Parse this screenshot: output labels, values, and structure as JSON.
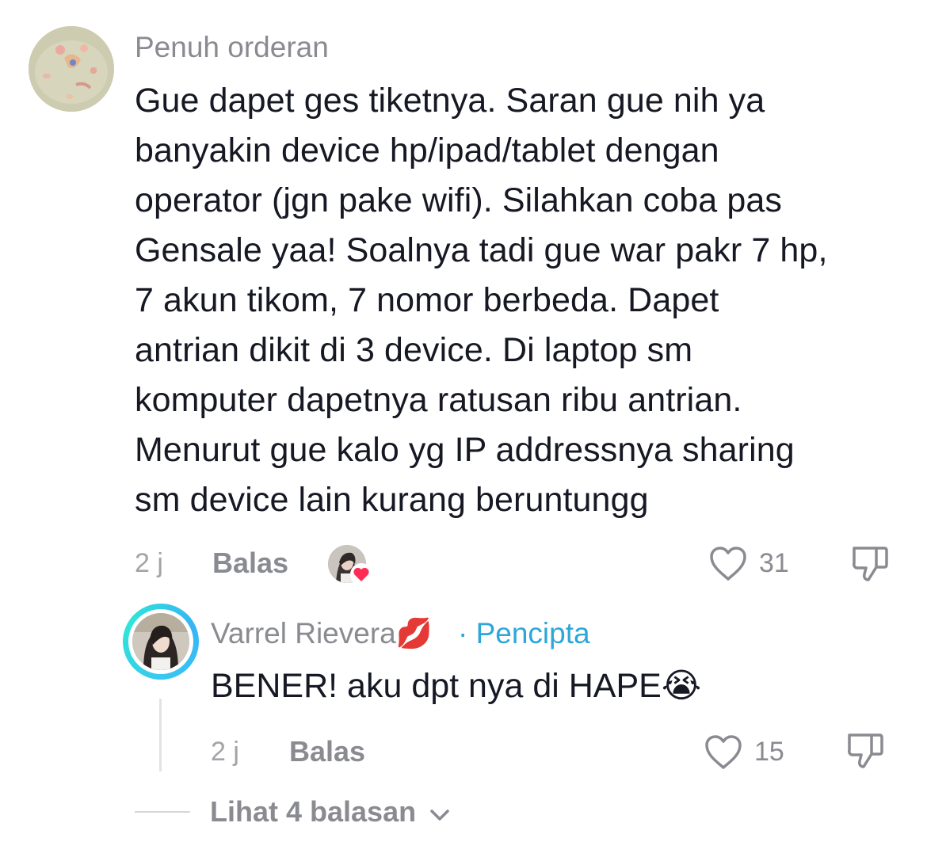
{
  "comment": {
    "username": "Penuh orderan",
    "text_lines": [
      "Gue dapet ges tiketnya. Saran gue nih ya",
      "banyakin device hp/ipad/tablet dengan",
      "operator (jgn pake wifi). Silahkan coba pas",
      "Gensale yaa! Soalnya tadi gue war pakr 7 hp,",
      "7 akun tikom, 7 nomor berbeda. Dapet",
      "antrian dikit di 3 device. Di laptop sm",
      "komputer dapetnya ratusan ribu antrian.",
      "Menurut gue kalo yg IP addressnya sharing",
      "sm device lain kurang beruntungg"
    ],
    "time": "2 j",
    "reply_label": "Balas",
    "like_count": "31"
  },
  "reply": {
    "username": "Varrel Rievera💋",
    "creator_label": "· Pencipta",
    "text": "BENER! aku dpt nya di HAPE😭",
    "time": "2 j",
    "reply_label": "Balas",
    "like_count": "15"
  },
  "view_replies": {
    "label": "Lihat 4 balasan"
  },
  "icons": {
    "like": "heart-outline-icon",
    "dislike": "thumbs-down-icon",
    "creator_liked": "heart-filled-icon",
    "expand": "chevron-down-icon"
  },
  "colors": {
    "text": "#161823",
    "muted": "#8a8b91",
    "creator_blue": "#2da7d8",
    "heart_red": "#fe2c55"
  }
}
